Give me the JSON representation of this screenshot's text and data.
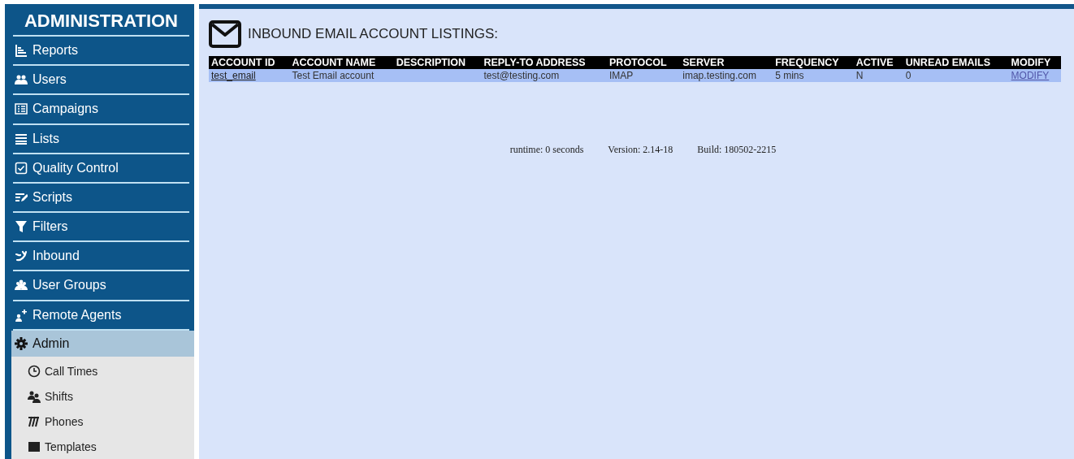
{
  "sidebar": {
    "title": "ADMINISTRATION",
    "items": [
      {
        "label": "Reports",
        "kind": "main",
        "selected": false
      },
      {
        "label": "Users",
        "kind": "main",
        "selected": false
      },
      {
        "label": "Campaigns",
        "kind": "main",
        "selected": false
      },
      {
        "label": "Lists",
        "kind": "main",
        "selected": false
      },
      {
        "label": "Quality Control",
        "kind": "main",
        "selected": false
      },
      {
        "label": "Scripts",
        "kind": "main",
        "selected": false
      },
      {
        "label": "Filters",
        "kind": "main",
        "selected": false
      },
      {
        "label": "Inbound",
        "kind": "main",
        "selected": false
      },
      {
        "label": "User Groups",
        "kind": "main",
        "selected": false
      },
      {
        "label": "Remote Agents",
        "kind": "main",
        "selected": false
      },
      {
        "label": "Admin",
        "kind": "main",
        "selected": true
      },
      {
        "label": "Call Times",
        "kind": "sub",
        "selected": false
      },
      {
        "label": "Shifts",
        "kind": "sub",
        "selected": false
      },
      {
        "label": "Phones",
        "kind": "sub",
        "selected": false
      },
      {
        "label": "Templates",
        "kind": "sub",
        "selected": false
      }
    ]
  },
  "page": {
    "title": "INBOUND EMAIL ACCOUNT LISTINGS:"
  },
  "table": {
    "columns": [
      "ACCOUNT ID",
      "ACCOUNT NAME",
      "DESCRIPTION",
      "REPLY-TO ADDRESS",
      "PROTOCOL",
      "SERVER",
      "FREQUENCY",
      "ACTIVE",
      "UNREAD EMAILS",
      "MODIFY"
    ],
    "rows": [
      {
        "account_id": "test_email",
        "account_name": "Test Email account",
        "reply_to": "test@testing.com",
        "protocol": "IMAP",
        "server": "imap.testing.com",
        "frequency": "5 mins",
        "active": "N",
        "unread": "0",
        "modify": "MODIFY"
      }
    ]
  },
  "footer": {
    "runtime": "runtime: 0 seconds",
    "version": "Version: 2.14-18",
    "build": "Build: 180502-2215"
  }
}
